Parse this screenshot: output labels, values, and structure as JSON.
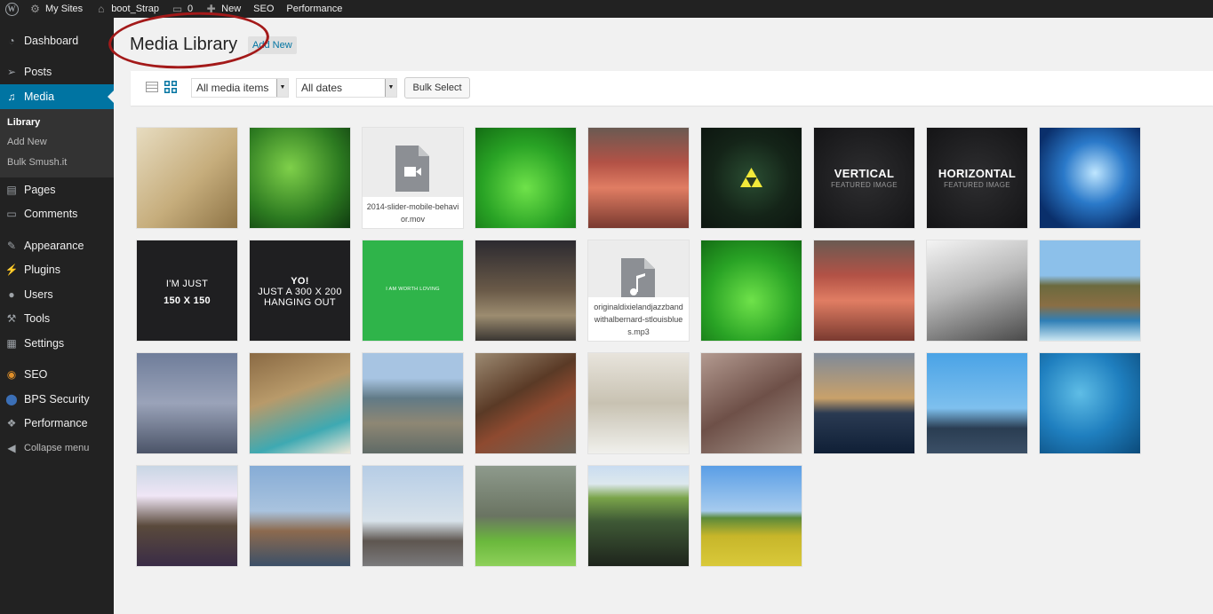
{
  "adminbar": {
    "my_sites": "My Sites",
    "site_name": "boot_Strap",
    "comments_count": "0",
    "new_label": "New",
    "seo": "SEO",
    "performance": "Performance"
  },
  "sidebar": {
    "items": [
      {
        "label": "Dashboard",
        "icon": "dashboard-icon"
      },
      {
        "label": "Posts",
        "icon": "pin-icon"
      },
      {
        "label": "Media",
        "icon": "media-icon",
        "active": true
      },
      {
        "label": "Pages",
        "icon": "pages-icon"
      },
      {
        "label": "Comments",
        "icon": "comment-icon"
      },
      {
        "label": "Appearance",
        "icon": "brush-icon"
      },
      {
        "label": "Plugins",
        "icon": "plug-icon"
      },
      {
        "label": "Users",
        "icon": "user-icon"
      },
      {
        "label": "Tools",
        "icon": "wrench-icon"
      },
      {
        "label": "Settings",
        "icon": "settings-icon"
      },
      {
        "label": "SEO",
        "icon": "seo-icon"
      },
      {
        "label": "BPS Security",
        "icon": "shield-icon"
      },
      {
        "label": "Performance",
        "icon": "performance-icon"
      },
      {
        "label": "Collapse menu",
        "icon": "collapse-icon"
      }
    ],
    "media_submenu": [
      "Library",
      "Add New",
      "Bulk Smush.it"
    ]
  },
  "page": {
    "title": "Media Library",
    "add_new": "Add New"
  },
  "toolbar": {
    "filter_type": "All media items",
    "filter_date": "All dates",
    "bulk_select": "Bulk Select"
  },
  "media": [
    {
      "kind": "photo",
      "subject": "glasses on old letter"
    },
    {
      "kind": "photo",
      "subject": "green fern"
    },
    {
      "kind": "file",
      "filetype": "video",
      "filename": "2014-slider-mobile-behavior.mov"
    },
    {
      "kind": "photo",
      "subject": "water drops on green leaf"
    },
    {
      "kind": "photo",
      "subject": "red grilled food"
    },
    {
      "kind": "photo",
      "subject": "glowing triangle on dark"
    },
    {
      "kind": "graphic",
      "line1": "VERTICAL",
      "line2": "FEATURED IMAGE"
    },
    {
      "kind": "graphic",
      "line1": "HORIZONTAL",
      "line2": "FEATURED IMAGE"
    },
    {
      "kind": "photo",
      "subject": "blue unicorn"
    },
    {
      "kind": "graphic",
      "line1": "I'M JUST",
      "line2": "150 X 150"
    },
    {
      "kind": "graphic",
      "line1": "YO!",
      "line2": "JUST A 300 X 200",
      "line3": "HANGING OUT"
    },
    {
      "kind": "graphic",
      "line1": "I AM WORTH LOVING"
    },
    {
      "kind": "photo",
      "subject": "city street at dusk"
    },
    {
      "kind": "file",
      "filetype": "audio",
      "filename": "originaldixielandjazzbandwithalbernard-stlouisblues.mp3"
    },
    {
      "kind": "photo",
      "subject": "water drops on green leaf"
    },
    {
      "kind": "photo",
      "subject": "red grilled food"
    },
    {
      "kind": "photo",
      "subject": "gray rock"
    },
    {
      "kind": "photo",
      "subject": "coastal cliffs"
    },
    {
      "kind": "photo",
      "subject": "misty sea"
    },
    {
      "kind": "photo",
      "subject": "waterfall beach"
    },
    {
      "kind": "photo",
      "subject": "rocky shore"
    },
    {
      "kind": "photo",
      "subject": "rusty rail tracks"
    },
    {
      "kind": "photo",
      "subject": "orange lily"
    },
    {
      "kind": "photo",
      "subject": "old wagon wheel"
    },
    {
      "kind": "photo",
      "subject": "sunset over water"
    },
    {
      "kind": "photo",
      "subject": "harbour bridge"
    },
    {
      "kind": "photo",
      "subject": "raindrops on water"
    },
    {
      "kind": "photo",
      "subject": "sun through trees"
    },
    {
      "kind": "photo",
      "subject": "golden gate bridge"
    },
    {
      "kind": "photo",
      "subject": "red pier tower"
    },
    {
      "kind": "photo",
      "subject": "green forest"
    },
    {
      "kind": "photo",
      "subject": "crop fields"
    },
    {
      "kind": "photo",
      "subject": "yellow field"
    }
  ],
  "colors": {
    "accent": "#0074a2",
    "annotation": "#a31919",
    "sidebar_bg": "#222222"
  }
}
